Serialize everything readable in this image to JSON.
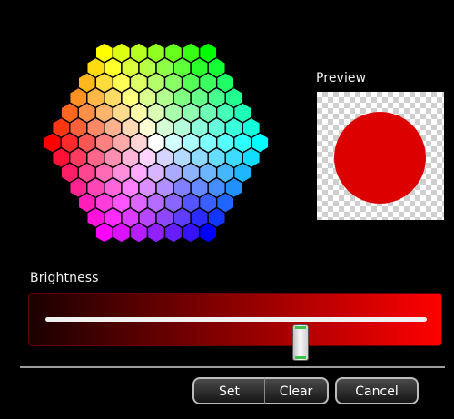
{
  "color_picker": {
    "selected_color": "#dd0000",
    "outline_color": "#000000"
  },
  "preview": {
    "label": "Preview",
    "color": "#dd0000"
  },
  "brightness": {
    "label": "Brightness",
    "value_fraction": 0.67,
    "color_from": "#1a0000",
    "color_to": "#ff0000"
  },
  "buttons": {
    "set": "Set",
    "clear": "Clear",
    "cancel": "Cancel"
  }
}
